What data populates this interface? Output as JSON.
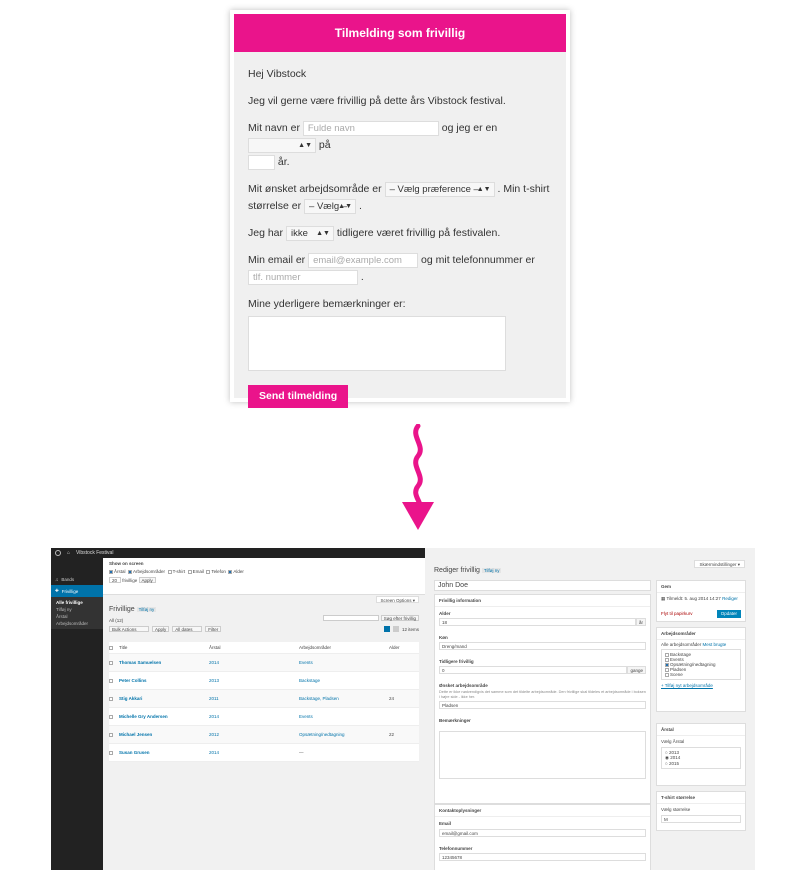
{
  "form": {
    "title": "Tilmelding som frivillig",
    "greeting": "Hej Vibstock",
    "intro": "Jeg vil gerne være frivillig på dette års Vibstock festival.",
    "name_prefix": "Mit navn er",
    "name_placeholder": "Fulde navn",
    "name_middle": "og jeg er en",
    "name_suffix": "på",
    "years_suffix": "år.",
    "area_prefix": "Mit ønsket arbejdsområde er",
    "area_select": "– Vælg præference –",
    "area_middle": ". Min t-shirt",
    "size_prefix": "størrelse er",
    "size_select": "– Vælg –",
    "size_suffix": ".",
    "before_prefix": "Jeg har",
    "before_select": "ikke",
    "before_suffix": "tidligere været frivillig på festivalen.",
    "email_prefix": "Min email er",
    "email_placeholder": "email@example.com",
    "email_middle": "og mit telefonnummer er",
    "phone_placeholder": "tlf. nummer",
    "phone_suffix": ".",
    "remarks_label": "Mine yderligere bemærkninger er:",
    "submit_label": "Send tilmelding"
  },
  "admin": {
    "site_name": "Vibstock Festival",
    "menu": {
      "bands": "Bands",
      "frivillige": "Frivillige",
      "sub": [
        "Alle frivillige",
        "Tilføj ny",
        "Årstal",
        "Arbejdsområder"
      ]
    },
    "screen_options": {
      "title": "Show on screen",
      "columns": [
        "Årstal",
        "Arbejdsområder",
        "T-shirt",
        "Email",
        "Telefon",
        "Alder"
      ],
      "per_page_value": "20",
      "per_page_label": "frivillige",
      "apply": "Apply",
      "toggle": "Screen Options ▾"
    },
    "list": {
      "title": "Frivillige",
      "add_new": "Tilføj ny",
      "filter_all": "All (12)",
      "bulk_actions": "Bulk Actions",
      "apply": "Apply",
      "all_dates": "All dates",
      "filter": "Filter",
      "search_btn": "Søg efter frivillig",
      "items_count": "12 items",
      "columns": [
        "Title",
        "Årstal",
        "Arbejdsområder",
        "Alder"
      ],
      "rows": [
        {
          "title": "Thomas Samuelsen",
          "year": "2014",
          "area": "Events",
          "age": ""
        },
        {
          "title": "Peter Collins",
          "year": "2013",
          "area": "Backstage",
          "age": ""
        },
        {
          "title": "Stig Akkari",
          "year": "2011",
          "area": "Backstage, Pladsen",
          "age": "24"
        },
        {
          "title": "Michelle Gry Andersen",
          "year": "2014",
          "area": "Events",
          "age": ""
        },
        {
          "title": "Michael Jensen",
          "year": "2012",
          "area": "Opsætning/nedtagning",
          "age": "22"
        },
        {
          "title": "Susan Grusen",
          "year": "2014",
          "area": "—",
          "age": ""
        }
      ]
    },
    "edit": {
      "screen_options": "Skærmindstillinger ▾",
      "title": "Rediger frivillig",
      "add_new": "Tilføj ny",
      "name": "John Doe",
      "info_box": "Frivillig information",
      "age_label": "Alder",
      "age_value": "18",
      "age_unit": "år",
      "gender_label": "Køn",
      "gender_value": "Dreng/mand",
      "prev_label": "Tidligere frivillig",
      "prev_value": "0",
      "prev_unit": "gange",
      "area_label": "Ønsket arbejdsområde",
      "area_help": "Dette er ikke nødvendigvis det samme som det tildelte arbejdsområde. Den frivillige skal tildeles et arbejdsområde i boksen i højre side - ikke her.",
      "area_value": "Pladsen",
      "remarks_label": "Bemærkninger",
      "contact_box": "Kontaktoplysninger",
      "email_label": "Email",
      "email_value": "email@gmail.com",
      "phone_label": "Telefonnummer",
      "phone_value": "12345678",
      "publish_box": "Gem",
      "published_on": "Tilmeldt: 5. aug 2014 14:27",
      "edit_link": "Rediger",
      "trash": "Flyt til papirkurv",
      "update": "Opdater",
      "areas_box": "Arbejdsområder",
      "areas_tab_all": "Alle arbejdsområder",
      "areas_tab_used": "Mest brugte",
      "areas": [
        {
          "label": "Backstage",
          "checked": false
        },
        {
          "label": "Events",
          "checked": false
        },
        {
          "label": "Opsætning/nedtagning",
          "checked": true
        },
        {
          "label": "Pladsen",
          "checked": false
        },
        {
          "label": "Scene",
          "checked": false
        }
      ],
      "areas_add": "+ Tilføj nyt arbejdsområde",
      "year_box": "Årstal",
      "year_label": "Vælg Årstal",
      "years": [
        {
          "label": "2013",
          "checked": false
        },
        {
          "label": "2014",
          "checked": true
        },
        {
          "label": "2015",
          "checked": false
        }
      ],
      "tshirt_box": "T-shirt størrelse",
      "tshirt_label": "Vælg størrelse",
      "tshirt_value": "M"
    }
  },
  "colors": {
    "accent": "#ea148b",
    "wp_dark": "#222222",
    "wp_blue": "#0073aa"
  }
}
